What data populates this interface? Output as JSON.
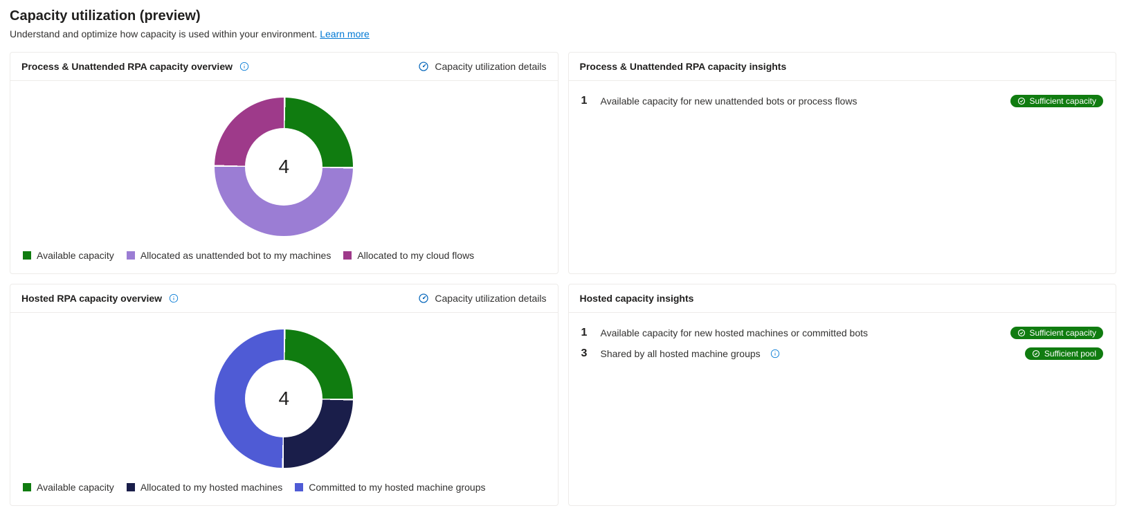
{
  "page": {
    "title": "Capacity utilization (preview)",
    "subtitle_text": "Understand and optimize how capacity is used within your environment. ",
    "learn_more": "Learn more"
  },
  "details_link_label": "Capacity utilization details",
  "cards": {
    "process_overview": {
      "title": "Process & Unattended RPA capacity overview",
      "center_value": "4",
      "legend": [
        {
          "label": "Available capacity",
          "color": "#107c10"
        },
        {
          "label": "Allocated as unattended bot to my machines",
          "color": "#9b7dd4"
        },
        {
          "label": "Allocated to my cloud flows",
          "color": "#9e3a8a"
        }
      ]
    },
    "process_insights": {
      "title": "Process & Unattended RPA capacity insights",
      "items": [
        {
          "num": "1",
          "text": "Available capacity for new unattended bots or process flows",
          "badge": "Sufficient capacity",
          "info": false
        }
      ]
    },
    "hosted_overview": {
      "title": "Hosted RPA capacity overview",
      "center_value": "4",
      "legend": [
        {
          "label": "Available capacity",
          "color": "#107c10"
        },
        {
          "label": "Allocated to my hosted machines",
          "color": "#1a1e4a"
        },
        {
          "label": "Committed to my hosted machine groups",
          "color": "#4f5bd5"
        }
      ]
    },
    "hosted_insights": {
      "title": "Hosted capacity insights",
      "items": [
        {
          "num": "1",
          "text": "Available capacity for new hosted machines or committed bots",
          "badge": "Sufficient capacity",
          "info": false
        },
        {
          "num": "3",
          "text": "Shared by all hosted machine groups",
          "badge": "Sufficient pool",
          "info": true
        }
      ]
    }
  },
  "chart_data": [
    {
      "type": "pie",
      "title": "Process & Unattended RPA capacity overview",
      "total": 4,
      "series": [
        {
          "name": "Available capacity",
          "value": 1,
          "color": "#107c10"
        },
        {
          "name": "Allocated as unattended bot to my machines",
          "value": 2,
          "color": "#9b7dd4"
        },
        {
          "name": "Allocated to my cloud flows",
          "value": 1,
          "color": "#9e3a8a"
        }
      ]
    },
    {
      "type": "pie",
      "title": "Hosted RPA capacity overview",
      "total": 4,
      "series": [
        {
          "name": "Available capacity",
          "value": 1,
          "color": "#107c10"
        },
        {
          "name": "Allocated to my hosted machines",
          "value": 1,
          "color": "#1a1e4a"
        },
        {
          "name": "Committed to my hosted machine groups",
          "value": 2,
          "color": "#4f5bd5"
        }
      ]
    }
  ]
}
